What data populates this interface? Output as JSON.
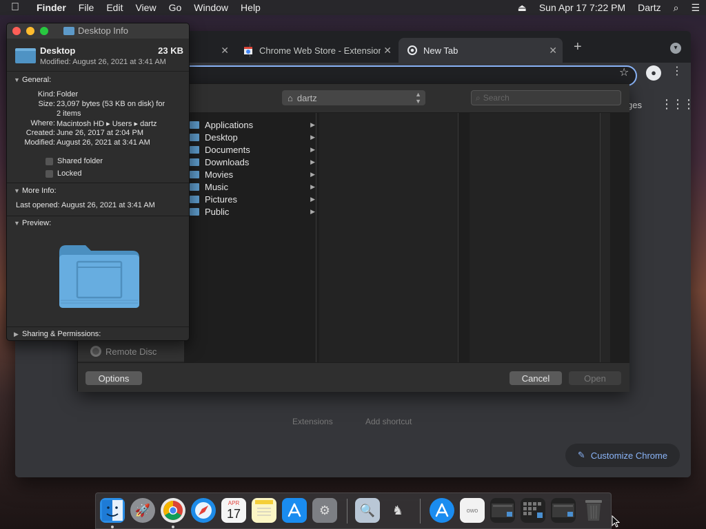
{
  "menubar": {
    "apple": "",
    "items": [
      "Finder",
      "File",
      "Edit",
      "View",
      "Go",
      "Window",
      "Help"
    ],
    "clock": "Sun Apr 17  7:22 PM",
    "user": "Dartz"
  },
  "chrome": {
    "tabs": [
      {
        "label": "",
        "active": false
      },
      {
        "label": "Chrome Web Store - Extension",
        "active": false
      },
      {
        "label": "New Tab",
        "active": true
      }
    ],
    "new_tab_symbol": "+",
    "ntp": {
      "images_label": "ges",
      "shortcut_labels": [
        "Extensions",
        "Add shortcut"
      ],
      "customize_label": "Customize Chrome"
    },
    "accent": "#8ab4f8"
  },
  "dialog": {
    "path_label": "dartz",
    "search_placeholder": "Search",
    "folders": [
      {
        "name": "Applications"
      },
      {
        "name": "Desktop"
      },
      {
        "name": "Documents"
      },
      {
        "name": "Downloads"
      },
      {
        "name": "Movies"
      },
      {
        "name": "Music"
      },
      {
        "name": "Pictures"
      },
      {
        "name": "Public"
      }
    ],
    "sidebar_remote": "Remote Disc",
    "options_label": "Options",
    "cancel_label": "Cancel",
    "open_label": "Open"
  },
  "info": {
    "window_title": "Desktop Info",
    "name": "Desktop",
    "size": "23 KB",
    "modified_line": "Modified: August 26, 2021 at 3:41 AM",
    "general_label": "General:",
    "general": {
      "kind_k": "Kind:",
      "kind_v": "Folder",
      "size_k": "Size:",
      "size_v1": "23,097 bytes (53 KB on disk) for",
      "size_v2": "2 items",
      "where_k": "Where:",
      "where_v": "Macintosh HD ▸ Users ▸ dartz",
      "created_k": "Created:",
      "created_v": "June 26, 2017 at 2:04 PM",
      "modified_k": "Modified:",
      "modified_v": "August 26, 2021 at 3:41 AM"
    },
    "shared_folder_label": "Shared folder",
    "locked_label": "Locked",
    "more_info_label": "More Info:",
    "last_opened": "Last opened: August 26, 2021 at 3:41 AM",
    "preview_label": "Preview:",
    "sharing_label": "Sharing & Permissions:"
  },
  "dock": {
    "calendar_month": "APR",
    "calendar_day": "17",
    "owo_label": "owo"
  }
}
